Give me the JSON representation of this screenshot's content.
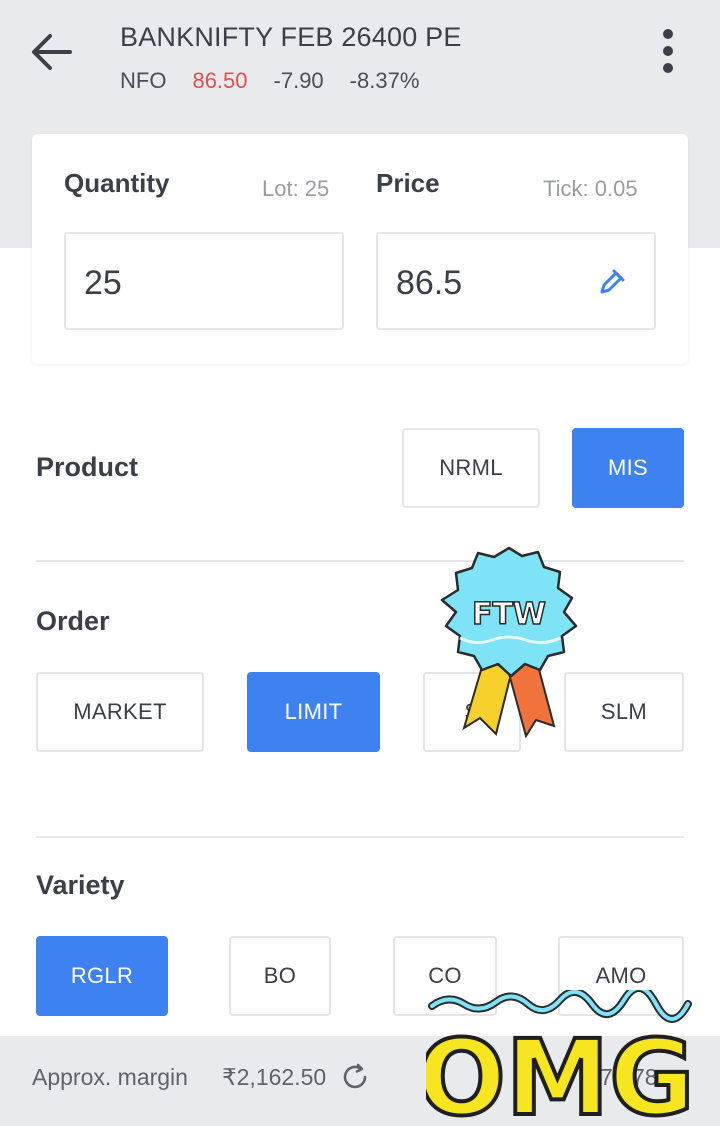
{
  "header": {
    "title": "BANKNIFTY FEB 26400 PE",
    "exchange": "NFO",
    "ltp": "86.50",
    "change": "-7.90",
    "change_pct": "-8.37%",
    "ltp_color": "#df514c",
    "back_icon": "arrow-left-icon",
    "menu_icon": "kebab-menu-icon"
  },
  "order_form": {
    "quantity_label": "Quantity",
    "lot_hint": "Lot: 25",
    "quantity_value": "25",
    "price_label": "Price",
    "tick_hint": "Tick: 0.05",
    "price_value": "86.5",
    "price_edit_icon": "pencil-icon"
  },
  "product": {
    "label": "Product",
    "options": [
      "NRML",
      "MIS"
    ],
    "selected": "MIS"
  },
  "order": {
    "label": "Order",
    "options": [
      "MARKET",
      "LIMIT",
      "SL",
      "SLM"
    ],
    "selected": "LIMIT",
    "sl_visible_text": "S"
  },
  "variety": {
    "label": "Variety",
    "options": [
      "RGLR",
      "BO",
      "CO",
      "AMO"
    ],
    "selected": "RGLR"
  },
  "footer": {
    "margin_label": "Approx. margin",
    "margin_value": "₹2,162.50",
    "refresh_icon": "refresh-icon",
    "charges_partial": "75.78"
  },
  "stickers": {
    "badge_text": "FTW",
    "omg_text": "OMG"
  },
  "colors": {
    "accent": "#3e82f1",
    "header_bg": "#e9eaed"
  }
}
